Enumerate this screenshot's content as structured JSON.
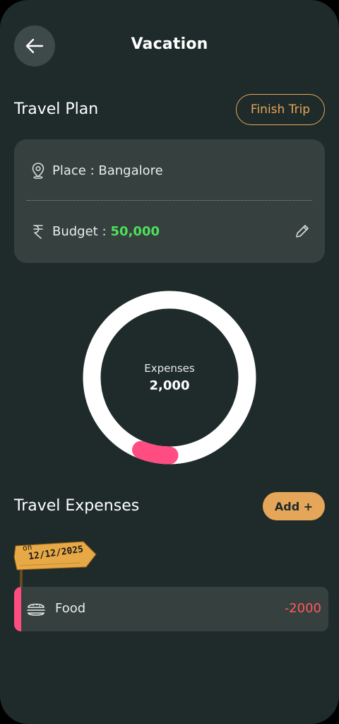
{
  "header": {
    "title": "Vacation"
  },
  "plan": {
    "section_title": "Travel Plan",
    "finish_label": "Finish Trip",
    "place_label": "Place : Bangalore",
    "budget_label": "Budget :",
    "budget_value": "50,000"
  },
  "summary": {
    "label": "Expenses",
    "value": "2,000",
    "spent_fraction": 0.04
  },
  "expenses": {
    "section_title": "Travel Expenses",
    "add_label": "Add +",
    "date_prefix": "on",
    "date": "12/12/2025",
    "items": [
      {
        "name": "Food",
        "amount": "-2000",
        "icon": "burger-icon"
      }
    ]
  },
  "colors": {
    "background": "#1e2b2a",
    "card": "#35403f",
    "accent": "#e5a65a",
    "budget": "#4ee05a",
    "expense": "#ff4d82",
    "negative": "#ff5a5a"
  }
}
